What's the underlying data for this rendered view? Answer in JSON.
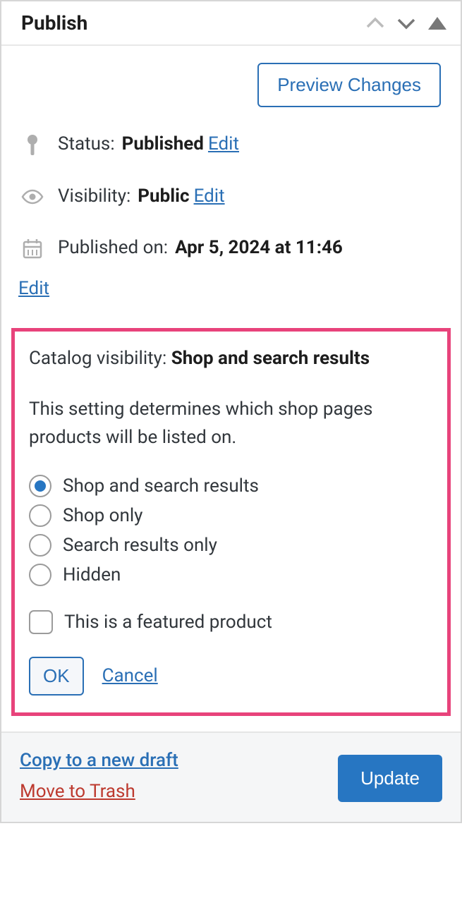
{
  "panel": {
    "title": "Publish"
  },
  "preview": {
    "label": "Preview Changes"
  },
  "status": {
    "label": "Status:",
    "value": "Published",
    "edit": "Edit"
  },
  "visibility": {
    "label": "Visibility:",
    "value": "Public",
    "edit": "Edit"
  },
  "published": {
    "label": "Published on:",
    "value": "Apr 5, 2024 at 11:46",
    "edit": "Edit"
  },
  "catalog": {
    "label": "Catalog visibility:",
    "value": "Shop and search results",
    "desc": "This setting determines which shop pages products will be listed on.",
    "options": [
      {
        "label": "Shop and search results",
        "checked": true
      },
      {
        "label": "Shop only",
        "checked": false
      },
      {
        "label": "Search results only",
        "checked": false
      },
      {
        "label": "Hidden",
        "checked": false
      }
    ],
    "featured_label": "This is a featured product",
    "featured_checked": false,
    "ok": "OK",
    "cancel": "Cancel"
  },
  "footer": {
    "copy": "Copy to a new draft",
    "trash": "Move to Trash",
    "update": "Update"
  }
}
